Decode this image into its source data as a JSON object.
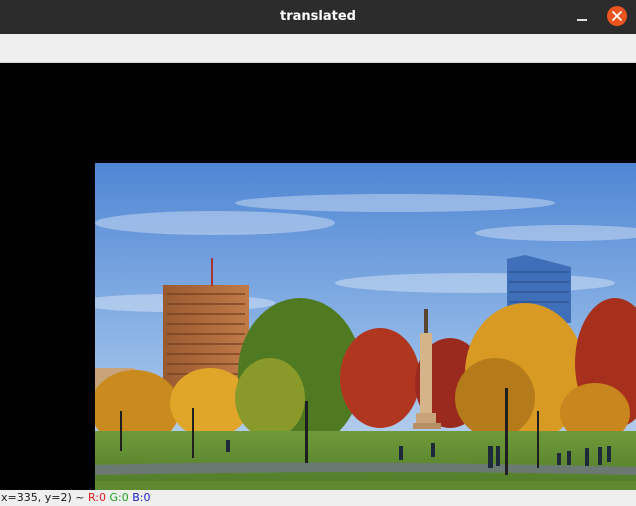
{
  "window": {
    "title": "translated",
    "minimize_icon": "minimize-icon",
    "close_icon": "close-icon",
    "close_color": "#e9541f"
  },
  "image": {
    "description_icon": "park-photo",
    "sky_color": "#5b8fd6"
  },
  "status": {
    "coords": "x=335, y=2) ~",
    "r": "R:0",
    "g": "G:0",
    "b": "B:0"
  }
}
